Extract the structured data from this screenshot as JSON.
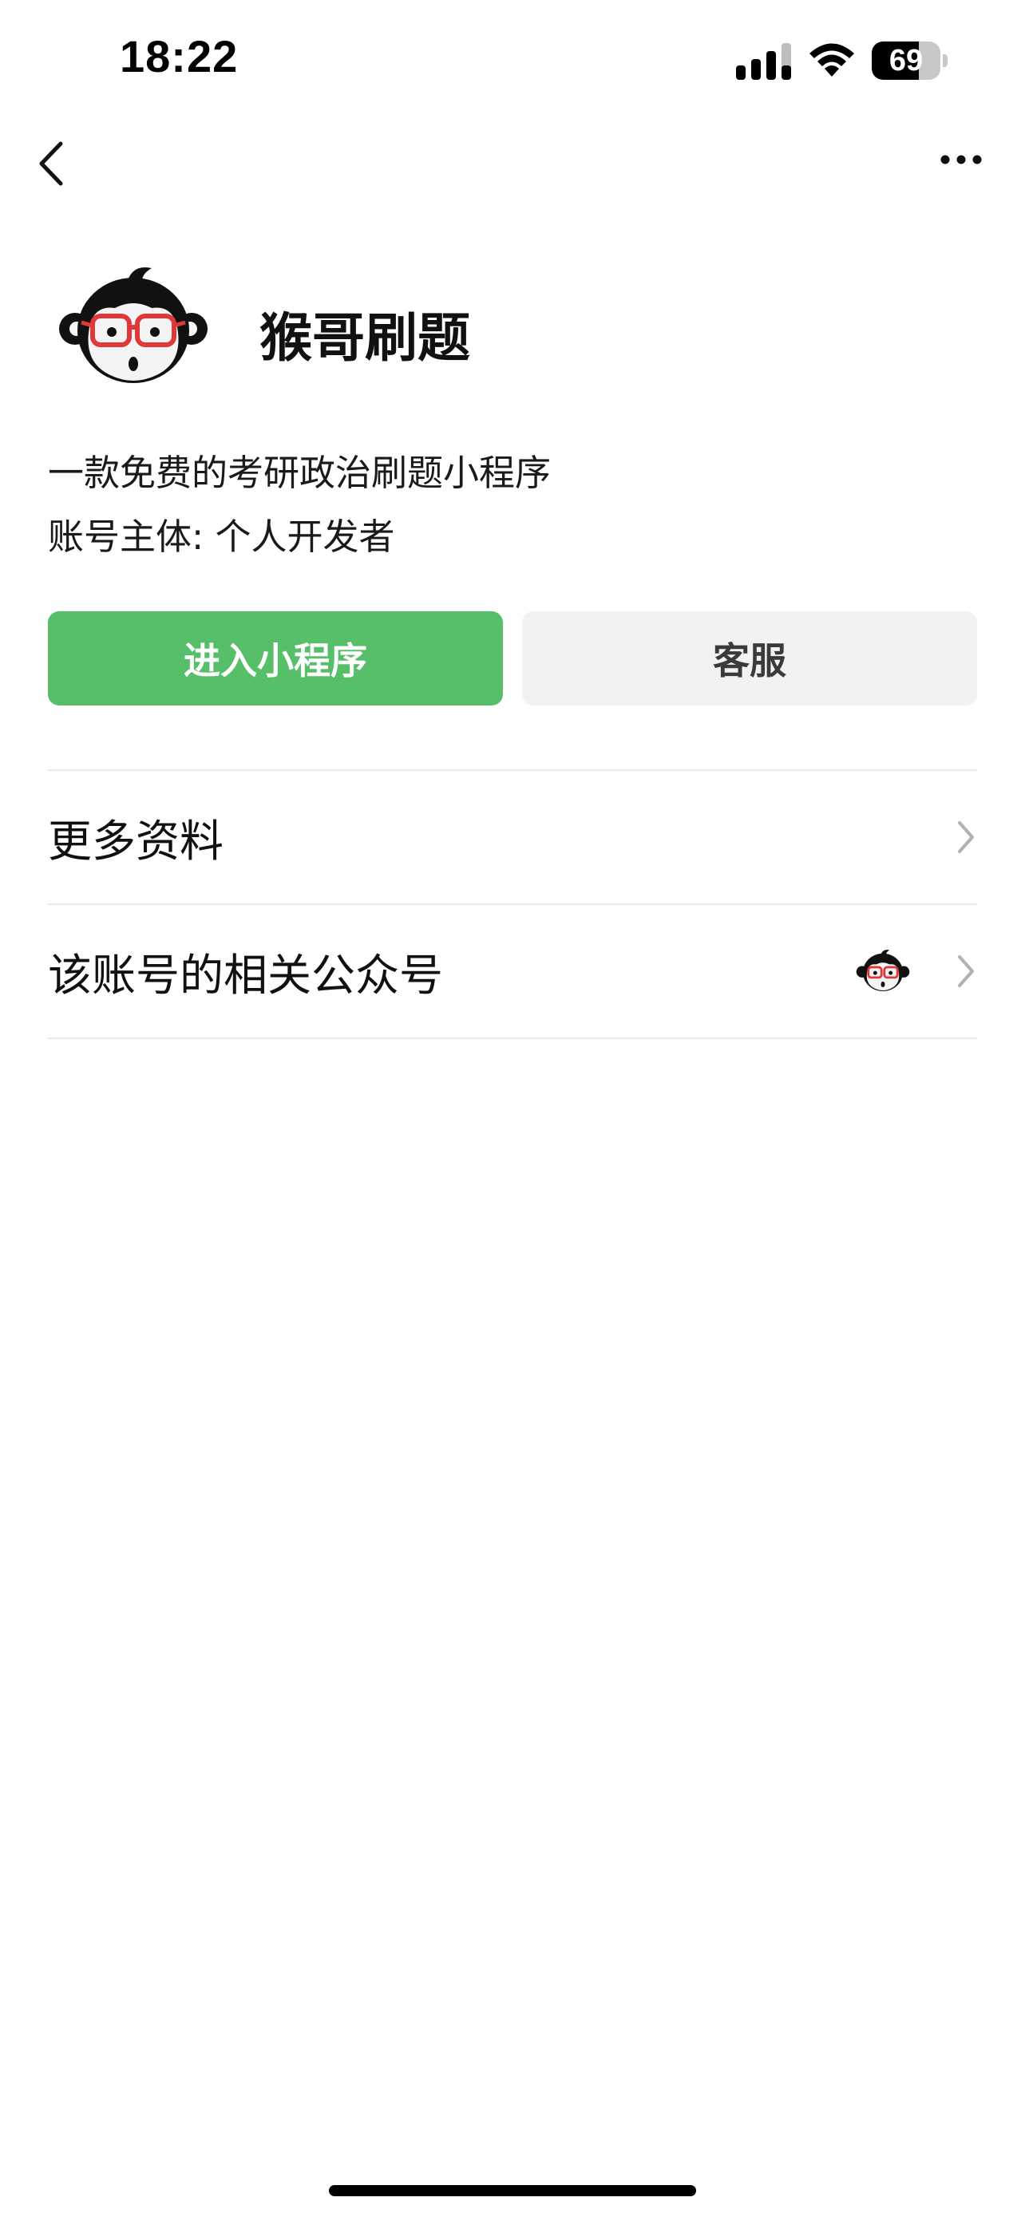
{
  "status_bar": {
    "time": "18:22",
    "battery_text": "69",
    "battery_level": 0.69,
    "icons": [
      "signal-icon",
      "wifi-icon",
      "battery-icon"
    ]
  },
  "nav": {
    "back_icon": "chevron-left-icon",
    "more_icon": "more-dots-icon"
  },
  "profile": {
    "avatar_icon": "monkey-logo-icon",
    "name": "猴哥刷题",
    "description": "一款免费的考研政治刷题小程序",
    "owner": "账号主体: 个人开发者"
  },
  "actions": {
    "enter_label": "进入小程序",
    "service_label": "客服",
    "accent_color": "#57be6a"
  },
  "list": {
    "items": [
      {
        "label": "更多资料",
        "icon": "chevron-right-icon"
      },
      {
        "label": "该账号的相关公众号",
        "icon": "chevron-right-icon",
        "thumbnail": "monkey-logo-icon"
      }
    ]
  }
}
